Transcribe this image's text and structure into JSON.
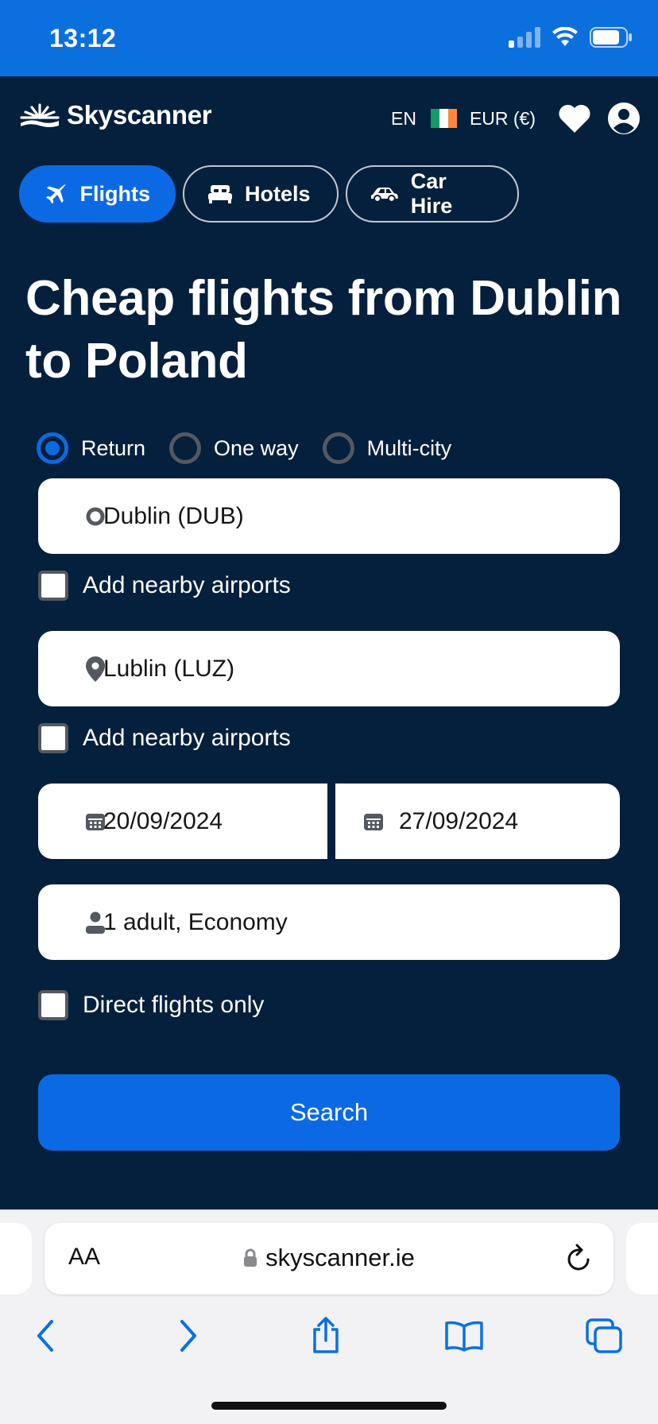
{
  "status_bar": {
    "time": "13:12"
  },
  "header": {
    "logo_text": "Skyscanner",
    "language": "EN",
    "currency": "EUR (€)",
    "flag_colors": [
      "#169b62",
      "#ffffff",
      "#ff883e"
    ]
  },
  "tabs": [
    {
      "label": "Flights",
      "icon": "plane-icon",
      "active": true
    },
    {
      "label": "Hotels",
      "icon": "bed-icon",
      "active": false
    },
    {
      "label": "Car Hire",
      "icon": "car-icon",
      "active": false
    }
  ],
  "page_title": "Cheap flights from Dublin to Poland",
  "trip_types": [
    {
      "label": "Return",
      "selected": true
    },
    {
      "label": "One way",
      "selected": false
    },
    {
      "label": "Multi-city",
      "selected": false
    }
  ],
  "search_form": {
    "origin": "Dublin (DUB)",
    "origin_nearby_label": "Add nearby airports",
    "destination": "Lublin (LUZ)",
    "destination_nearby_label": "Add nearby airports",
    "depart_date": "20/09/2024",
    "return_date": "27/09/2024",
    "travellers": "1 adult, Economy",
    "direct_label": "Direct flights only",
    "search_label": "Search"
  },
  "browser": {
    "text_size_label": "AA",
    "url": "skyscanner.ie"
  },
  "colors": {
    "brand_blue": "#0b6ae3",
    "background_navy": "#05203c",
    "status_bar_blue": "#0b70de"
  }
}
